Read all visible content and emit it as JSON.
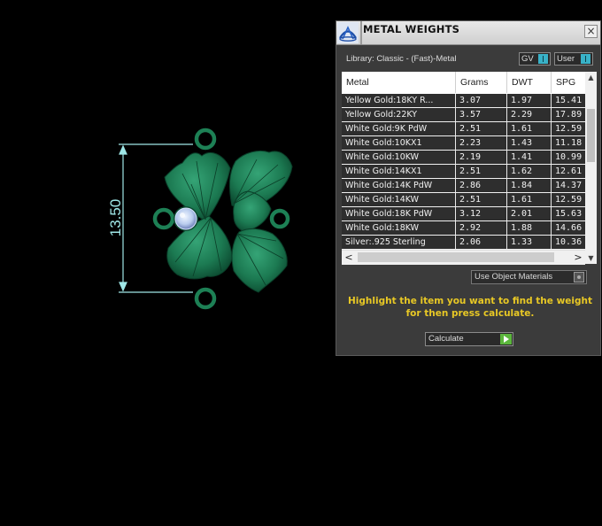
{
  "viewport": {
    "dimension_label": "13.50",
    "colors": {
      "metal": "#1e7a52",
      "dimension_lines": "#9fe7e7",
      "gem": "#b9ccee"
    }
  },
  "panel": {
    "title": "METAL WEIGHTS",
    "close_glyph": "×",
    "library_label": "Library: Classic - (Fast)-Metal",
    "toggles": {
      "gv": "GV",
      "user": "User"
    },
    "table": {
      "headers": [
        "Metal",
        "Grams",
        "DWT",
        "SPG"
      ],
      "rows": [
        [
          "Yellow Gold:18KY R...",
          "3.07",
          "1.97",
          "15.41"
        ],
        [
          "Yellow Gold:22KY",
          "3.57",
          "2.29",
          "17.89"
        ],
        [
          "White Gold:9K PdW",
          "2.51",
          "1.61",
          "12.59"
        ],
        [
          "White Gold:10KX1",
          "2.23",
          "1.43",
          "11.18"
        ],
        [
          "White Gold:10KW",
          "2.19",
          "1.41",
          "10.99"
        ],
        [
          "White Gold:14KX1",
          "2.51",
          "1.62",
          "12.61"
        ],
        [
          "White Gold:14K PdW",
          "2.86",
          "1.84",
          "14.37"
        ],
        [
          "White Gold:14KW",
          "2.51",
          "1.61",
          "12.59"
        ],
        [
          "White Gold:18K PdW",
          "3.12",
          "2.01",
          "15.63"
        ],
        [
          "White Gold:18KW",
          "2.92",
          "1.88",
          "14.66"
        ],
        [
          "Silver:.925 Sterling",
          "2.06",
          "1.33",
          "10.36"
        ]
      ]
    },
    "use_object_materials": "Use Object Materials",
    "instructions": "Highlight the item you want to find the weight for then press calculate.",
    "calculate_label": "Calculate",
    "colors": {
      "accent_cyan": "#39b2c8",
      "instruction_yellow": "#e8c825",
      "calculate_green": "#5bb63c"
    }
  }
}
